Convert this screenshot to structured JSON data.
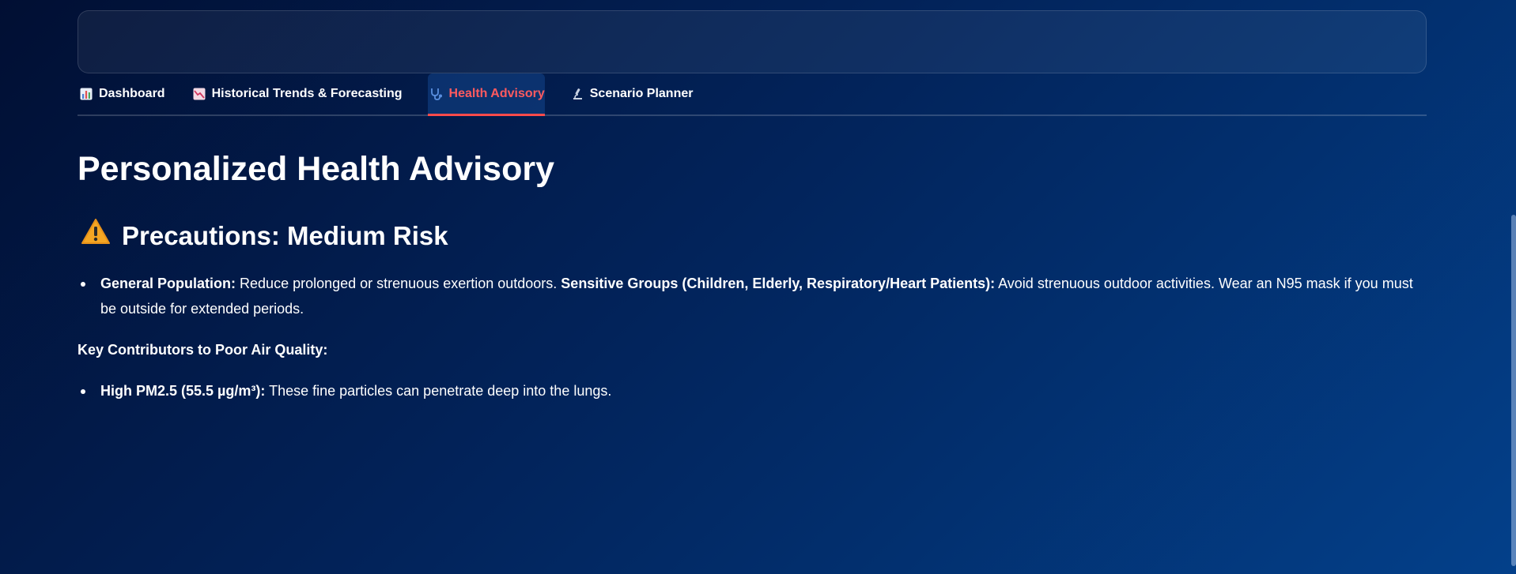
{
  "tabs": [
    {
      "label": "Dashboard",
      "icon": "bar-chart-icon",
      "active": false
    },
    {
      "label": "Historical Trends & Forecasting",
      "icon": "trending-down-chart-icon",
      "active": false
    },
    {
      "label": "Health Advisory",
      "icon": "stethoscope-icon",
      "active": true
    },
    {
      "label": "Scenario Planner",
      "icon": "microscope-icon",
      "active": false
    }
  ],
  "main": {
    "title": "Personalized Health Advisory",
    "risk_heading": {
      "icon": "warning-icon",
      "text": "Precautions: Medium Risk"
    },
    "precautions": {
      "general_label": "General Population:",
      "general_text": " Reduce prolonged or strenuous exertion outdoors. ",
      "sensitive_label": "Sensitive Groups (Children, Elderly, Respiratory/Heart Patients):",
      "sensitive_text": " Avoid strenuous outdoor activities. Wear an N95 mask if you must be outside for extended periods."
    },
    "contributors_label": "Key Contributors to Poor Air Quality:",
    "contributors": [
      {
        "label": "High PM2.5 (55.5 µg/m³):",
        "text": " These fine particles can penetrate deep into the lungs."
      }
    ]
  },
  "colors": {
    "active_tab": "#ff5a5f",
    "tab_underline": "#ff4b4b",
    "warning": "#f5a623",
    "background_start": "#010f33",
    "background_end": "#03408a"
  }
}
